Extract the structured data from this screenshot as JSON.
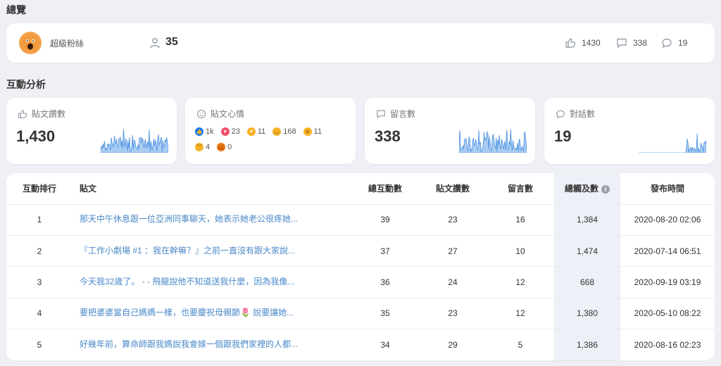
{
  "overview": {
    "section_title": "總覽",
    "page_name": "超級粉絲",
    "fans_count": "35",
    "likes": "1430",
    "comments": "338",
    "conversations": "19"
  },
  "analysis": {
    "section_title": "互動分析",
    "cards": [
      {
        "label": "貼文讚數",
        "value": "1,430"
      },
      {
        "label": "貼文心情",
        "value": ""
      },
      {
        "label": "留言數",
        "value": "338"
      },
      {
        "label": "對話數",
        "value": "19"
      }
    ],
    "reactions": [
      {
        "icon": "like-reaction-icon",
        "color": "#1877f2",
        "count": "1k"
      },
      {
        "icon": "love-reaction-icon",
        "color": "#f0506e",
        "count": "23"
      },
      {
        "icon": "care-reaction-icon",
        "color": "#f7b125",
        "count": "11"
      },
      {
        "icon": "haha-reaction-icon",
        "color": "#f7b125",
        "count": "168"
      },
      {
        "icon": "wow-reaction-icon",
        "color": "#f7b125",
        "count": "11"
      },
      {
        "icon": "sad-reaction-icon",
        "color": "#f7b125",
        "count": "4"
      },
      {
        "icon": "angry-reaction-icon",
        "color": "#e9710f",
        "count": "0"
      }
    ]
  },
  "table": {
    "headers": {
      "rank": "互動排行",
      "post": "貼文",
      "total": "總互動數",
      "likes": "貼文讚數",
      "comments": "留言數",
      "reach": "總觸及數",
      "time": "發布時間"
    },
    "rows": [
      {
        "rank": "1",
        "post": "那天中午休息跟一位亞洲同事聊天，她表示她老公很疼她...",
        "total": "39",
        "likes": "23",
        "comments": "16",
        "reach": "1,384",
        "time": "2020-08-20 02:06"
      },
      {
        "rank": "2",
        "post": "『工作小劇場 #1 ：我在幹嘛？』之前一直沒有跟大家說...",
        "total": "37",
        "likes": "27",
        "comments": "10",
        "reach": "1,474",
        "time": "2020-07-14 06:51"
      },
      {
        "rank": "3",
        "post": "今天我32歲了。 - - 飛龍說他不知道送我什麼，因為我像...",
        "total": "36",
        "likes": "24",
        "comments": "12",
        "reach": "668",
        "time": "2020-09-19 03:19"
      },
      {
        "rank": "4",
        "post": "要把婆婆當自己媽媽一樣，也要慶祝母親節🌷 說要讓她...",
        "total": "35",
        "likes": "23",
        "comments": "12",
        "reach": "1,380",
        "time": "2020-05-10 08:22"
      },
      {
        "rank": "5",
        "post": "好幾年前，算命師跟我媽說我會嫁一個跟我們家裡的人都...",
        "total": "34",
        "likes": "29",
        "comments": "5",
        "reach": "1,386",
        "time": "2020-08-16 02:23"
      }
    ]
  },
  "colors": {
    "accent": "#4a90e2",
    "link": "#4a89c9",
    "background": "#eef0f6"
  }
}
